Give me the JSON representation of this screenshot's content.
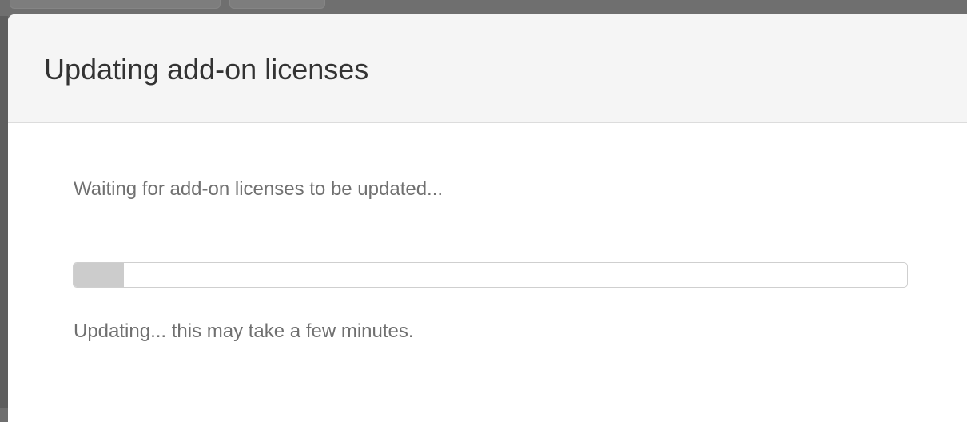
{
  "dialog": {
    "title": "Updating add-on licenses",
    "message": "Waiting for add-on licenses to be updated...",
    "status": "Updating... this may take a few minutes.",
    "progress_fraction": 0.06
  },
  "colors": {
    "header_bg": "#f5f5f5",
    "title_text": "#333333",
    "body_text": "#707070",
    "progress_fill": "#cccccc",
    "progress_border": "#cfcfcf",
    "backdrop": "#6f6f6f"
  }
}
